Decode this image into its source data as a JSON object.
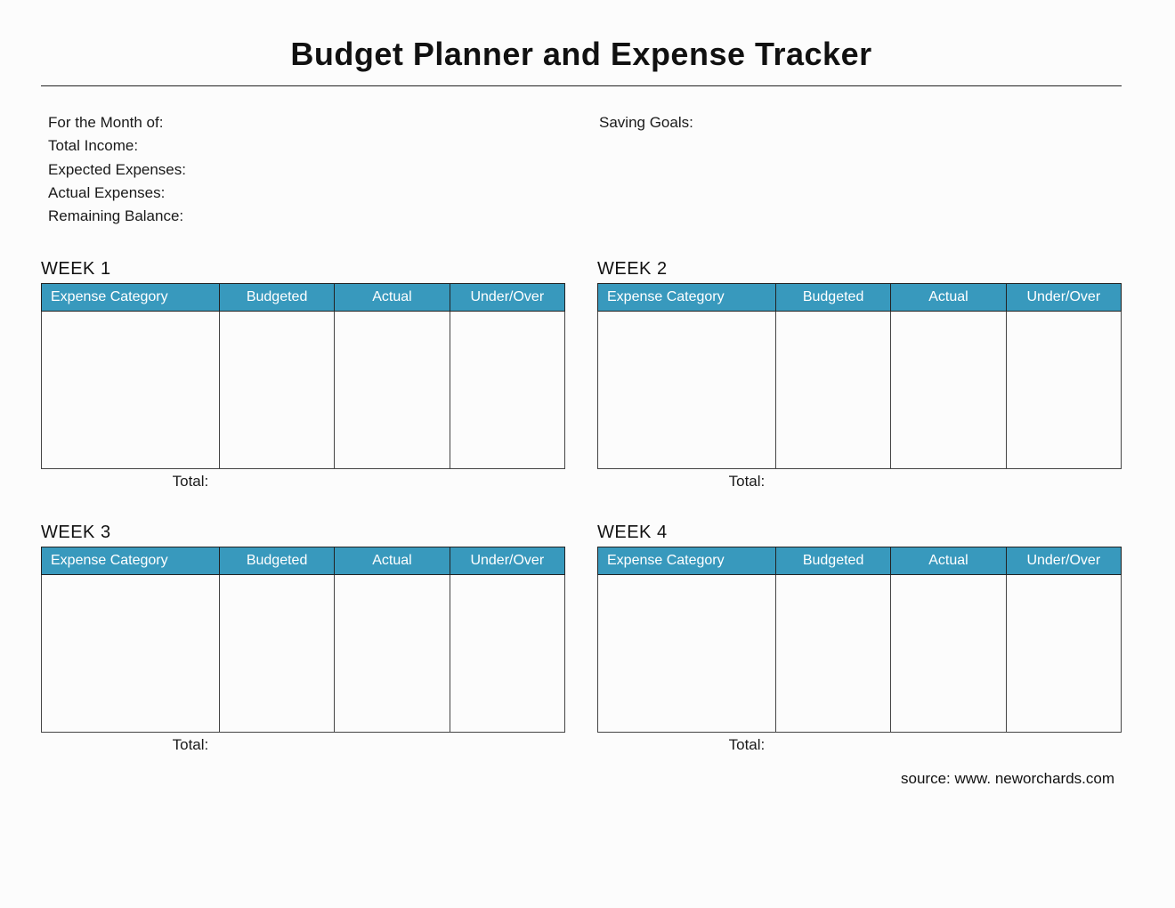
{
  "title": "Budget Planner and Expense Tracker",
  "summary": {
    "month_label": "For the Month of:",
    "total_income_label": "Total Income:",
    "expected_expenses_label": "Expected Expenses:",
    "actual_expenses_label": "Actual Expenses:",
    "remaining_balance_label": "Remaining Balance:",
    "saving_goals_label": "Saving Goals:"
  },
  "columns": {
    "category": "Expense Category",
    "budgeted": "Budgeted",
    "actual": "Actual",
    "under_over": "Under/Over"
  },
  "weeks": [
    {
      "title": "WEEK 1",
      "total_label": "Total:"
    },
    {
      "title": "WEEK 2",
      "total_label": "Total:"
    },
    {
      "title": "WEEK 3",
      "total_label": "Total:"
    },
    {
      "title": "WEEK 4",
      "total_label": "Total:"
    }
  ],
  "source": "source: www. neworchards.com"
}
